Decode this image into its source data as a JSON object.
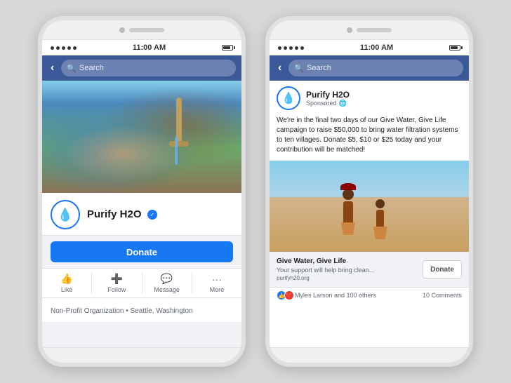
{
  "background": "#d8d8d8",
  "colors": {
    "facebook_blue": "#1877f2",
    "fb_nav_blue": "#3b5998",
    "text_dark": "#1c1e21",
    "text_gray": "#606770",
    "border": "#e0e0e0",
    "bg_light": "#f0f2f5"
  },
  "phone_left": {
    "status_bar": {
      "dots": 5,
      "time": "11:00 AM",
      "battery": ""
    },
    "nav": {
      "search_placeholder": "Search"
    },
    "page": {
      "name": "Purify H2O",
      "verified": true,
      "donate_button": "Donate",
      "actions": [
        {
          "icon": "👍",
          "label": "Like"
        },
        {
          "icon": "➕",
          "label": "Follow"
        },
        {
          "icon": "💬",
          "label": "Message"
        },
        {
          "icon": "···",
          "label": "More"
        }
      ],
      "page_info": "Non-Profit Organization • Seattle, Washington"
    }
  },
  "phone_right": {
    "status_bar": {
      "dots": 5,
      "time": "11:00 AM"
    },
    "nav": {
      "search_placeholder": "Search"
    },
    "post": {
      "page_name": "Purify H2O",
      "sponsored": "Sponsored",
      "globe": "🌐",
      "body": "We're in the final two days of our Give Water, Give Life campaign to raise $50,000 to bring water filtration systems to ten villages. Donate $5, $10 or $25 today and your contribution will be matched!",
      "link_title": "Give Water, Give Life",
      "link_desc": "Your support will help bring clean...",
      "link_url": "purifyh20.org",
      "donate_button": "Donate",
      "reactions_text": "Myles Larson and 100 others",
      "comments": "10 Comments"
    }
  }
}
